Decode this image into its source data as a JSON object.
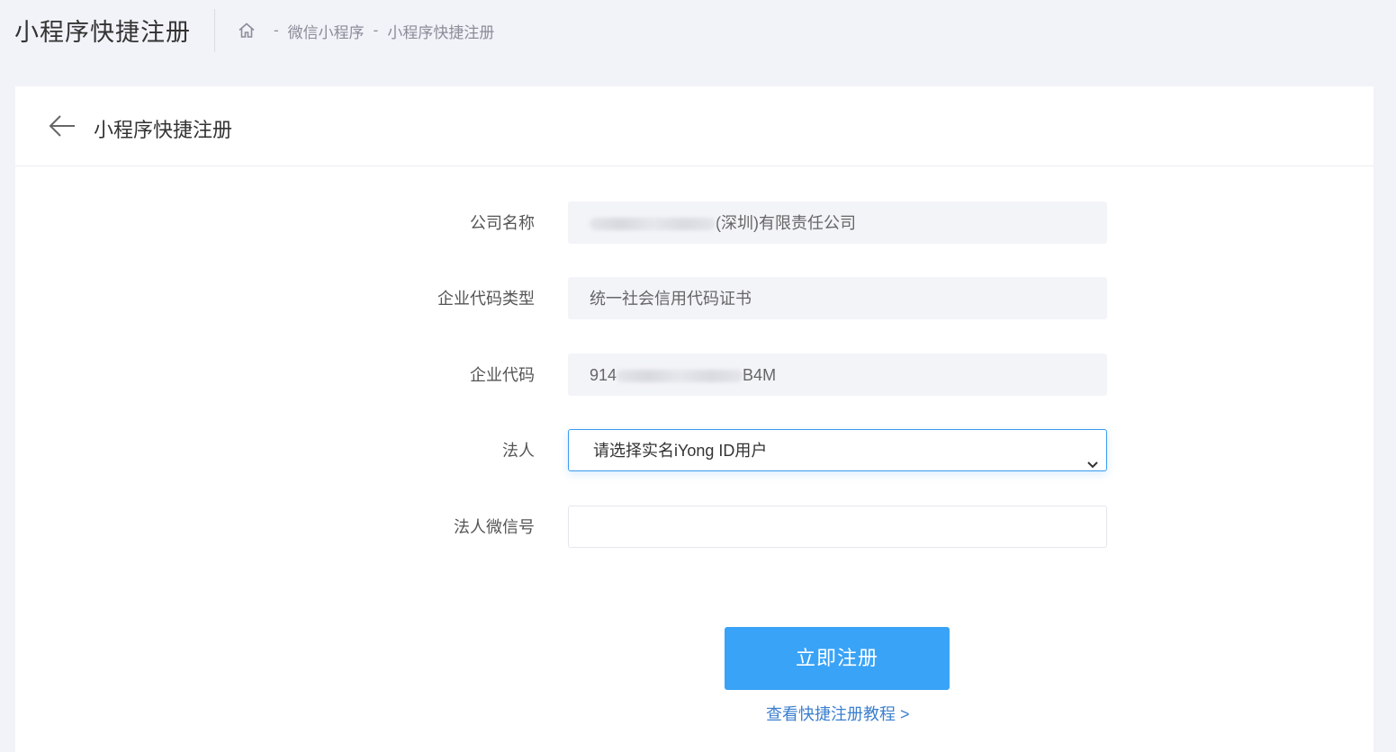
{
  "header": {
    "page_title": "小程序快捷注册",
    "breadcrumb": {
      "items": [
        "微信小程序",
        "小程序快捷注册"
      ],
      "separator": "-"
    }
  },
  "card": {
    "title": "小程序快捷注册"
  },
  "form": {
    "company_name": {
      "label": "公司名称",
      "value_visible_suffix": "(深圳)有限责任公司"
    },
    "code_type": {
      "label": "企业代码类型",
      "value": "统一社会信用代码证书"
    },
    "enterprise_code": {
      "label": "企业代码",
      "value_prefix": "914",
      "value_suffix": "B4M"
    },
    "legal_person": {
      "label": "法人",
      "selected": "请选择实名iYong ID用户"
    },
    "legal_wechat": {
      "label": "法人微信号",
      "value": ""
    }
  },
  "actions": {
    "submit_label": "立即注册",
    "tutorial_link": "查看快捷注册教程 >"
  },
  "colors": {
    "primary": "#39a3f7",
    "link": "#3b7fcf",
    "page_bg": "#f2f3f8",
    "field_bg": "#f3f4f8",
    "select_border": "#3a9bf0"
  }
}
